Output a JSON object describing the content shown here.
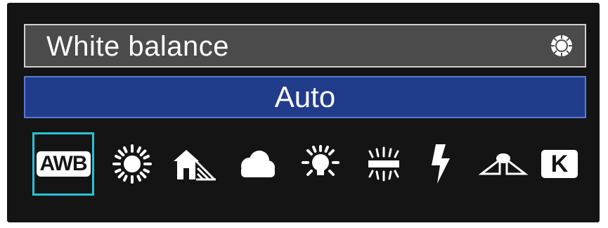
{
  "menu": {
    "title": "White balance",
    "title_icon": "dial-icon",
    "current_mode": "Auto"
  },
  "modes": [
    {
      "label": "AWB",
      "icon": "awb-icon",
      "selected": true
    },
    {
      "icon": "daylight-sun-icon",
      "selected": false
    },
    {
      "icon": "shade-house-icon",
      "selected": false
    },
    {
      "icon": "cloudy-icon",
      "selected": false
    },
    {
      "icon": "tungsten-bulb-icon",
      "selected": false
    },
    {
      "icon": "fluorescent-tube-icon",
      "selected": false
    },
    {
      "icon": "flash-bolt-icon",
      "selected": false
    },
    {
      "icon": "custom-wb-icon",
      "selected": false
    },
    {
      "label": "K",
      "icon": "kelvin-icon",
      "selected": false
    }
  ],
  "colors": {
    "selection_outline": "#27c4d6",
    "mode_bar": "#223c8c",
    "title_bar": "#4b4b4b"
  }
}
